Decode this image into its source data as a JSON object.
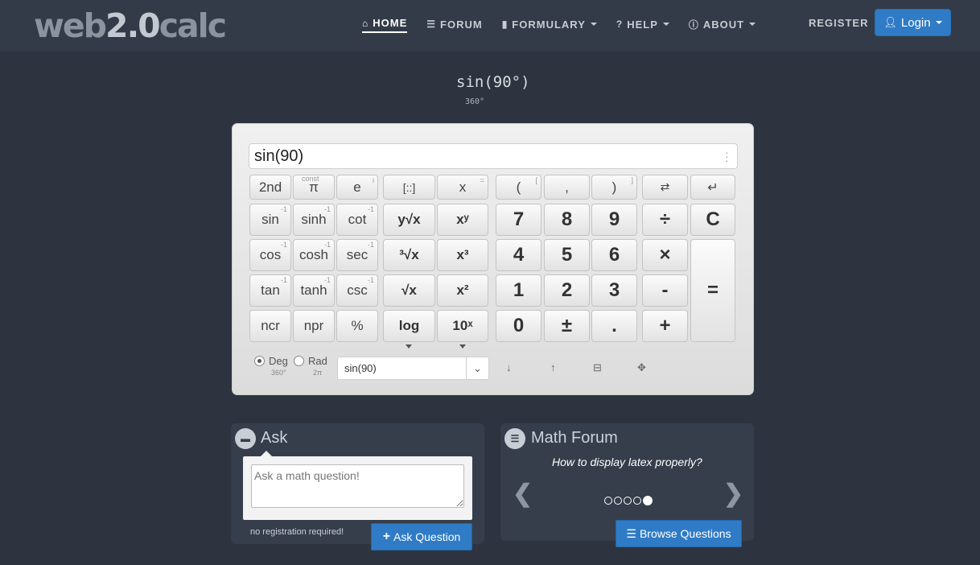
{
  "navbar": {
    "logo": {
      "part1": "web",
      "part2": "2.0",
      "part3": "calc"
    },
    "items": [
      {
        "label": "HOME",
        "icon": "home-icon"
      },
      {
        "label": "FORUM",
        "icon": "list-icon"
      },
      {
        "label": "FORMULARY",
        "icon": "book-icon"
      },
      {
        "label": "HELP",
        "icon": "question-icon"
      },
      {
        "label": "ABOUT",
        "icon": "info-icon"
      }
    ],
    "register": "REGISTER",
    "login": "Login"
  },
  "preview": {
    "expression": "sin(90°)",
    "sub": "360°"
  },
  "calculator": {
    "display": "sin(90)",
    "sci": {
      "r1": [
        "2nd",
        "π",
        "e",
        "[::]",
        "x"
      ],
      "r1_sup": {
        "pi": "const",
        "e": "i",
        "x": "="
      },
      "r2": [
        "sin",
        "sinh",
        "cot",
        "y√x",
        "xʸ"
      ],
      "r3": [
        "cos",
        "cosh",
        "sec",
        "³√x",
        "x³"
      ],
      "r4": [
        "tan",
        "tanh",
        "csc",
        "√x",
        "x²"
      ],
      "r5": [
        "ncr",
        "npr",
        "%",
        "log",
        "10ˣ"
      ],
      "inv": "-1"
    },
    "num": {
      "r1": [
        "(",
        ",",
        ")",
        "⇄",
        "↵"
      ],
      "r1_sup": {
        "paren_open": "[",
        "paren_close": "]"
      },
      "r2": [
        "7",
        "8",
        "9",
        "÷",
        "C"
      ],
      "r3": [
        "4",
        "5",
        "6",
        "×"
      ],
      "r4": [
        "1",
        "2",
        "3",
        "-"
      ],
      "r5": [
        "0",
        "±",
        ".",
        "+"
      ],
      "equals": "="
    },
    "mode": {
      "deg": "Deg",
      "deg_sub": "360°",
      "rad": "Rad",
      "rad_sub": "2π",
      "selected": "Deg"
    },
    "history": "sin(90)"
  },
  "ask": {
    "title": "Ask",
    "placeholder": "Ask a math question!",
    "note": "no registration required!",
    "button": "Ask Question"
  },
  "forum": {
    "title": "Math Forum",
    "question": "How to display latex properly?",
    "button": "Browse Questions",
    "pager": {
      "total": 5,
      "active": 5
    }
  }
}
